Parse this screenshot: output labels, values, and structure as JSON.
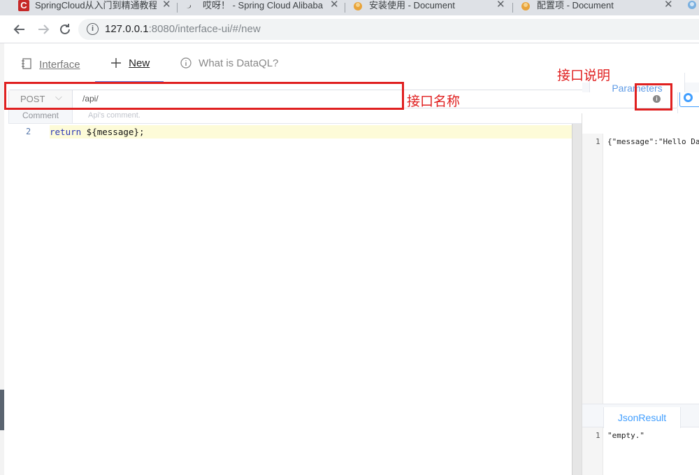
{
  "browser": {
    "tabs": [
      {
        "title": "SpringCloud从入门到精通教程/"
      },
      {
        "title": "哎呀！ - Spring Cloud Alibaba"
      },
      {
        "title": "安装使用 - Document"
      },
      {
        "title": "配置项 - Document"
      }
    ],
    "tab_close_glyph": "✕",
    "address": {
      "host": "127.0.0.1",
      "rest": ":8080/interface-ui/#/new"
    }
  },
  "app": {
    "nav": [
      {
        "label": "Interface",
        "icon": "notebook-icon"
      },
      {
        "label": "New",
        "icon": "plus-icon"
      },
      {
        "label": "What is DataQL?",
        "icon": "info-circle-icon"
      }
    ],
    "request": {
      "method": "POST",
      "path": "/api/",
      "comment_label": "Comment",
      "comment_placeholder": "Api's comment."
    },
    "editor": {
      "line_number": "2",
      "keyword": "return",
      "code": " ${message};"
    },
    "right_panel": {
      "tab_parameters": "Parameters",
      "param_line": "1",
      "param_code": "{\"message\":\"Hello Dat",
      "tab_result": "JsonResult",
      "result_line": "1",
      "result_code": "\"empty.\""
    }
  },
  "annotations": {
    "name_label": "接口名称",
    "comment_label": "接口说明",
    "color": "#e02020"
  }
}
